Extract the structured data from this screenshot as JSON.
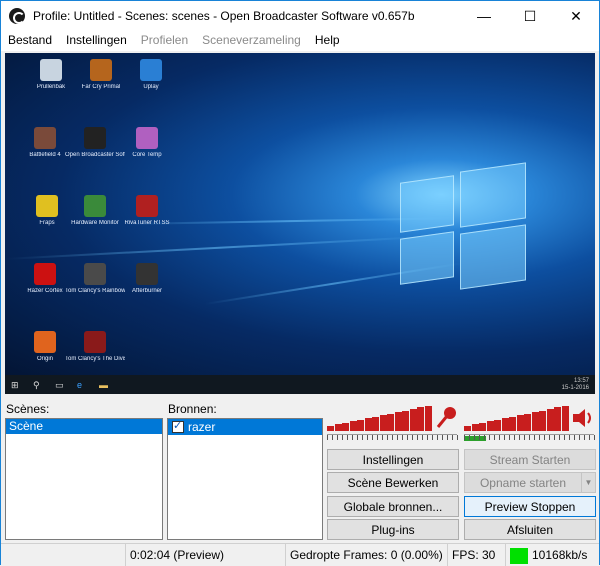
{
  "window": {
    "title": "Profile: Untitled - Scenes: scenes - Open Broadcaster Software v0.657b",
    "minimize_glyph": "—",
    "maximize_glyph": "☐",
    "close_glyph": "✕"
  },
  "menu": [
    {
      "label": "Bestand",
      "enabled": true
    },
    {
      "label": "Instellingen",
      "enabled": true
    },
    {
      "label": "Profielen",
      "enabled": false
    },
    {
      "label": "Sceneverzameling",
      "enabled": false
    },
    {
      "label": "Help",
      "enabled": true
    }
  ],
  "desktop": {
    "icons": [
      {
        "label": "Prullenbak",
        "color": "#c8d4e0"
      },
      {
        "label": "Far Cry Primal",
        "color": "#b5651d"
      },
      {
        "label": "Uplay",
        "color": "#2a7fd4"
      },
      {
        "label": "Battlefield 4",
        "color": "#7a4a3a"
      },
      {
        "label": "Open Broadcaster Software",
        "color": "#222222"
      },
      {
        "label": "Core Temp",
        "color": "#b060c0"
      },
      {
        "label": "Fraps",
        "color": "#e0c020"
      },
      {
        "label": "Hardware Monitor",
        "color": "#3a8a3a"
      },
      {
        "label": "RivaTuner RTSS",
        "color": "#b02020"
      },
      {
        "label": "Razer Cortex",
        "color": "#cc1111"
      },
      {
        "label": "Tom Clancy's Rainbow Six Siege",
        "color": "#4a4a4a"
      },
      {
        "label": "Afterburner",
        "color": "#333333"
      },
      {
        "label": "Origin",
        "color": "#e0641e"
      },
      {
        "label": "Tom Clancy's The Division",
        "color": "#8a1a1a"
      }
    ],
    "tray_time": "13:57",
    "tray_date": "15-1-2016"
  },
  "scenes": {
    "label": "Scènes:",
    "items": [
      "Scène"
    ],
    "selected": 0
  },
  "sources": {
    "label": "Bronnen:",
    "items": [
      {
        "name": "razer",
        "checked": true
      }
    ],
    "selected": 0
  },
  "audio": {
    "mic_level": 0.0,
    "desktop_level": 0.17,
    "mic_icon": "microphone-icon",
    "speaker_icon": "speaker-icon",
    "meter_color": "#c81e1e",
    "level_color": "#2ca02c"
  },
  "buttons": {
    "settings": "Instellingen",
    "stream_start": "Stream Starten",
    "edit_scene": "Scène Bewerken",
    "record_start": "Opname starten",
    "global_sources": "Globale bronnen...",
    "preview_stop": "Preview Stoppen",
    "plugins": "Plug-ins",
    "exit": "Afsluiten"
  },
  "status": {
    "time": "0:02:04 (Preview)",
    "dropped": "Gedropte Frames: 0 (0.00%)",
    "fps": "FPS: 30",
    "bitrate": "10168kb/s",
    "bitrate_indicator_color": "#00e000"
  }
}
